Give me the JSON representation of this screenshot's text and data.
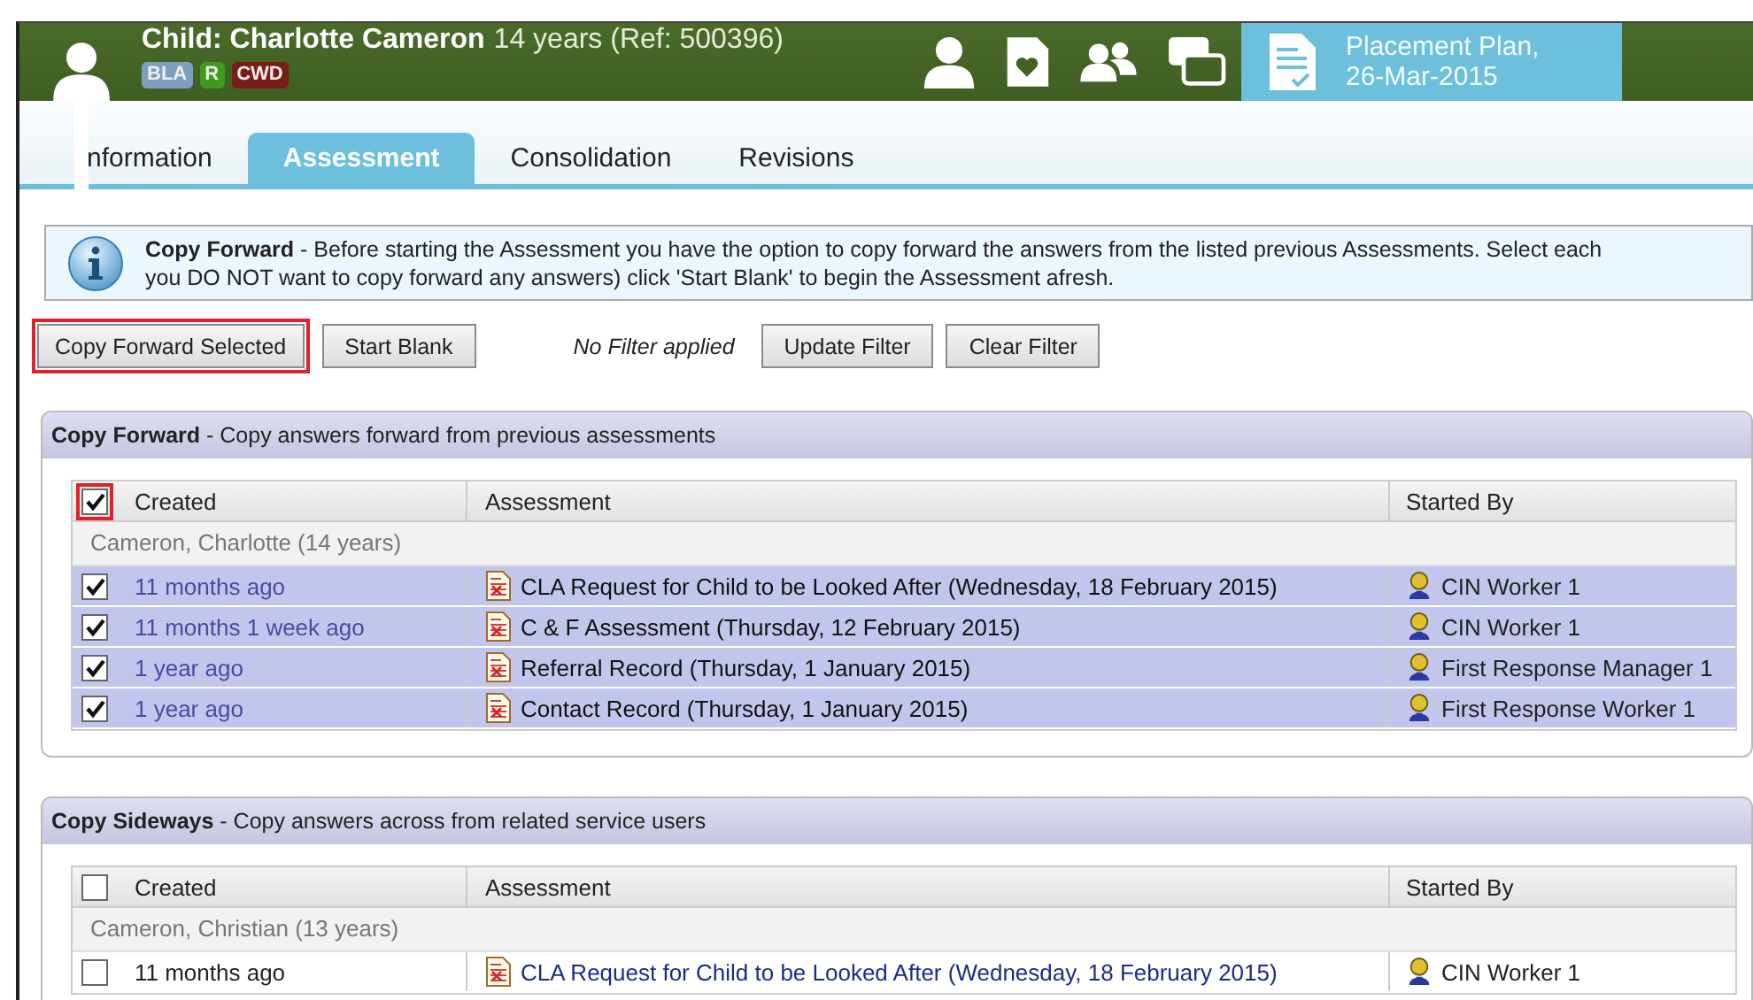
{
  "header": {
    "title": "Child: Charlotte Cameron",
    "subtitle": "14 years (Ref: 500396)",
    "badges": [
      {
        "label": "BLA",
        "color": "#7f9fbf"
      },
      {
        "label": "R",
        "color": "#3f9a1e"
      },
      {
        "label": "CWD",
        "color": "#7a1c16"
      }
    ],
    "current": {
      "line1": "Placement Plan,",
      "line2": "26-Mar-2015"
    }
  },
  "tabs": [
    {
      "label": "nformation",
      "selected": false
    },
    {
      "label": "Assessment",
      "selected": true
    },
    {
      "label": "Consolidation",
      "selected": false
    },
    {
      "label": "Revisions",
      "selected": false
    }
  ],
  "info": {
    "lines": [
      "**Copy Forward** - Before starting the Assessment you have the option to copy forward the answers from the listed previous Assessments. Select each",
      "you DO NOT want to copy forward any answers) click 'Start Blank' to begin the Assessment afresh."
    ]
  },
  "toolbar": {
    "buttons": [
      {
        "label": "Copy Forward Selected",
        "highlighted": true
      },
      {
        "label": "Start Blank",
        "highlighted": false
      }
    ],
    "filter_status": "No Filter applied",
    "filter_buttons": [
      {
        "label": "Update Filter",
        "highlighted": false
      },
      {
        "label": "Clear Filter",
        "highlighted": false
      }
    ]
  },
  "sections": [
    {
      "title": "Copy Forward",
      "description": "- Copy answers forward from previous assessments",
      "columns": [
        "Created",
        "Assessment",
        "Started By"
      ],
      "header_checked": true,
      "header_highlighted": true,
      "groups": [
        {
          "label": "Cameron, Charlotte (14 years)",
          "rows": [
            {
              "checked": true,
              "selected": true,
              "created": "11 months ago",
              "assessment": "CLA Request for Child to be Looked After (Wednesday, 18 February 2015)",
              "started_by": "CIN Worker 1"
            },
            {
              "checked": true,
              "selected": true,
              "created": "11 months 1 week ago",
              "assessment": "C & F Assessment (Thursday, 12 February 2015)",
              "started_by": "CIN Worker 1"
            },
            {
              "checked": true,
              "selected": true,
              "created": "1 year ago",
              "assessment": "Referral Record (Thursday, 1 January 2015)",
              "started_by": "First Response Manager 1"
            },
            {
              "checked": true,
              "selected": true,
              "created": "1 year ago",
              "assessment": "Contact Record (Thursday, 1 January 2015)",
              "started_by": "First Response Worker 1"
            }
          ]
        }
      ]
    },
    {
      "title": "Copy Sideways",
      "description": "- Copy answers across from related service users",
      "columns": [
        "Created",
        "Assessment",
        "Started By"
      ],
      "header_checked": false,
      "header_highlighted": false,
      "groups": [
        {
          "label": "Cameron, Christian (13 years)",
          "rows": [
            {
              "checked": false,
              "selected": false,
              "created": "11 months ago",
              "assessment": "CLA Request for Child to be Looked After (Wednesday, 18 February 2015)",
              "started_by": "CIN Worker 1"
            }
          ]
        }
      ]
    }
  ]
}
